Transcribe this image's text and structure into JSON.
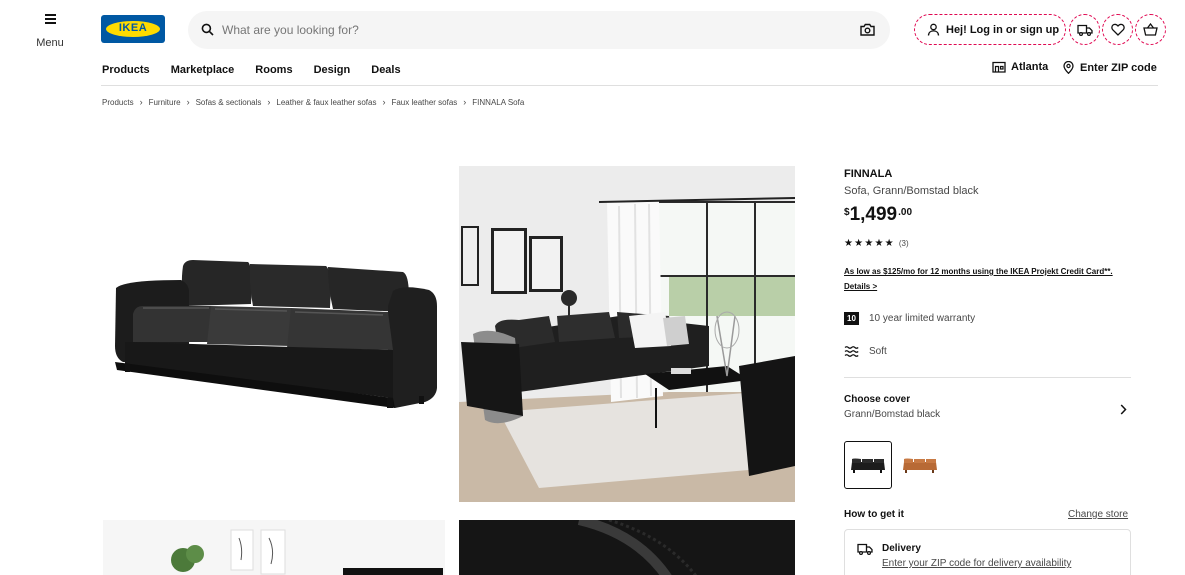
{
  "header": {
    "menu_label": "Menu",
    "logo_text": "IKEA",
    "search_placeholder": "What are you looking for?",
    "login_label": "Hej! Log in or sign up",
    "nav": [
      "Products",
      "Marketplace",
      "Rooms",
      "Design",
      "Deals"
    ],
    "store": "Atlanta",
    "zip": "Enter ZIP code"
  },
  "breadcrumbs": [
    "Products",
    "Furniture",
    "Sofas & sectionals",
    "Leather & faux leather sofas",
    "Faux leather sofas",
    "FINNALA Sofa"
  ],
  "product": {
    "name": "FINNALA",
    "description": "Sofa, Grann/Bomstad black",
    "currency": "$",
    "price_int": "1,499",
    "price_dec": ".00",
    "rating_stars": "★★★★★",
    "rating_value": 5,
    "review_count": "(3)",
    "credit_text": "As low as $125/mo for 12 months using the IKEA Projekt Credit Card**. Details >",
    "warranty_badge": "10",
    "warranty_text": "10 year limited warranty",
    "comfort_text": "Soft",
    "cover_title": "Choose cover",
    "cover_value": "Grann/Bomstad black",
    "swatches": [
      {
        "name": "Grann/Bomstad black",
        "color": "#1c1c1c"
      },
      {
        "name": "Grann/Bomstad golden-brown",
        "color": "#b86a35"
      }
    ],
    "how_to_get": "How to get it",
    "change_store": "Change store",
    "delivery_title": "Delivery",
    "delivery_link": "Enter your ZIP code for delivery availability"
  },
  "colors": {
    "brand_blue": "#0058a3",
    "brand_yellow": "#ffdb00",
    "focus_red": "#e00751"
  }
}
